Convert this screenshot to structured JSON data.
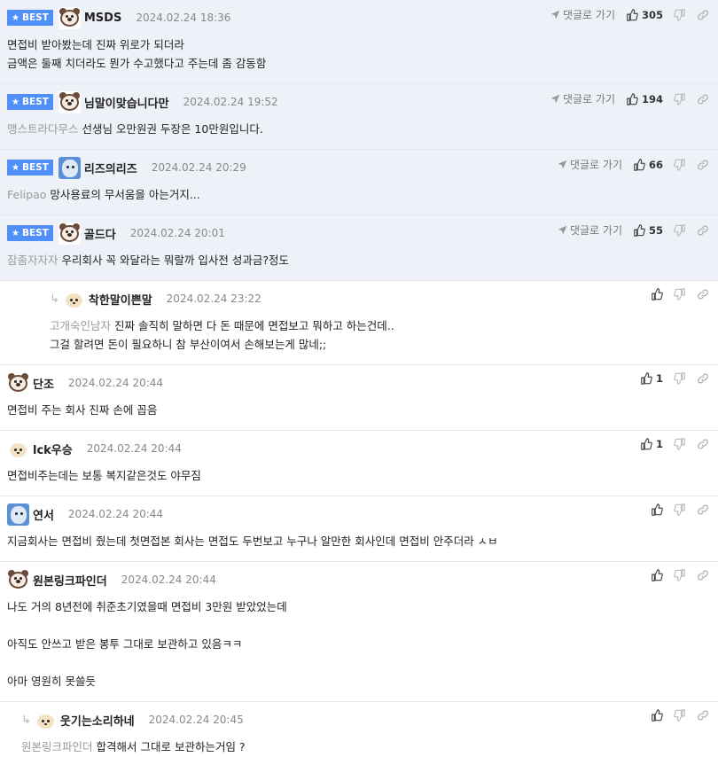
{
  "labels": {
    "best": "BEST",
    "goto": "댓글로 가기"
  },
  "comments": [
    {
      "id": "c1",
      "best": true,
      "avatar": "bear",
      "nick": "MSDS",
      "date": "2024.02.24 18:36",
      "likes": "305",
      "mention": "",
      "lines": [
        "면접비 받아봤는데 진짜 위로가 되더라",
        "금액은 둘째 치더라도 뭔가 수고했다고 주는데 좀 감동함"
      ]
    },
    {
      "id": "c2",
      "best": true,
      "avatar": "bear",
      "nick": "님말이맞습니다만",
      "date": "2024.02.24 19:52",
      "likes": "194",
      "mention": "맹스트라다무스",
      "lines": [
        "선생님 오만원권 두장은 10만원입니다."
      ]
    },
    {
      "id": "c3",
      "best": true,
      "avatar": "blue",
      "nick": "리즈의리즈",
      "date": "2024.02.24 20:29",
      "likes": "66",
      "mention": "Felipao",
      "lines": [
        "망사용료의 무서움을 아는거지..."
      ]
    },
    {
      "id": "c4",
      "best": true,
      "avatar": "bear",
      "nick": "골드다",
      "date": "2024.02.24 20:01",
      "likes": "55",
      "mention": "잠좀자자자",
      "lines": [
        "우리회사 꼭 와달라는 뭐랄까 입사전 성과금?정도"
      ]
    },
    {
      "id": "c5",
      "reply": true,
      "avatar": "dog",
      "nick": "착한말이쁜말",
      "date": "2024.02.24 23:22",
      "likes": "",
      "mention": "고개숙인남자",
      "lines": [
        "진짜 솔직히 말하면 다 돈 때문에 면접보고 뭐하고 하는건데..",
        "그걸 할려면 돈이 필요하니 참 부산이여서 손해보는게 많네;;"
      ]
    },
    {
      "id": "c6",
      "avatar": "bear",
      "nick": "단조",
      "date": "2024.02.24 20:44",
      "likes": "1",
      "mention": "",
      "lines": [
        "면접비 주는 회사 진짜 손에 꼽음"
      ]
    },
    {
      "id": "c7",
      "avatar": "dog",
      "nick": "lck우승",
      "date": "2024.02.24 20:44",
      "likes": "1",
      "mention": "",
      "lines": [
        "면접비주는데는 보통 복지같은것도 야무짐"
      ]
    },
    {
      "id": "c8",
      "avatar": "blue",
      "nick": "연서",
      "date": "2024.02.24 20:44",
      "likes": "",
      "mention": "",
      "lines": [
        "지금회사는 면접비 줬는데 첫면접본 회사는 면접도 두번보고 누구나 알만한 회사인데 면접비 안주더라 ㅅㅂ"
      ]
    },
    {
      "id": "c9",
      "avatar": "bear",
      "nick": "원본링크파인더",
      "date": "2024.02.24 20:44",
      "likes": "",
      "mention": "",
      "lines": [
        "나도 거의 8년전에 취준초기였을때 면접비 3만원 받았었는데",
        "",
        "아직도 안쓰고 받은 봉투 그대로 보관하고 있음ㅋㅋ",
        "",
        "아마 영원히 못쓸듯"
      ]
    },
    {
      "id": "c10",
      "reply": true,
      "r2": true,
      "avatar": "dog",
      "nick": "웃기는소리하네",
      "date": "2024.02.24 20:45",
      "likes": "",
      "mention": "원본링크파인더",
      "lines": [
        "합격해서 그대로 보관하는거임 ?"
      ]
    }
  ]
}
